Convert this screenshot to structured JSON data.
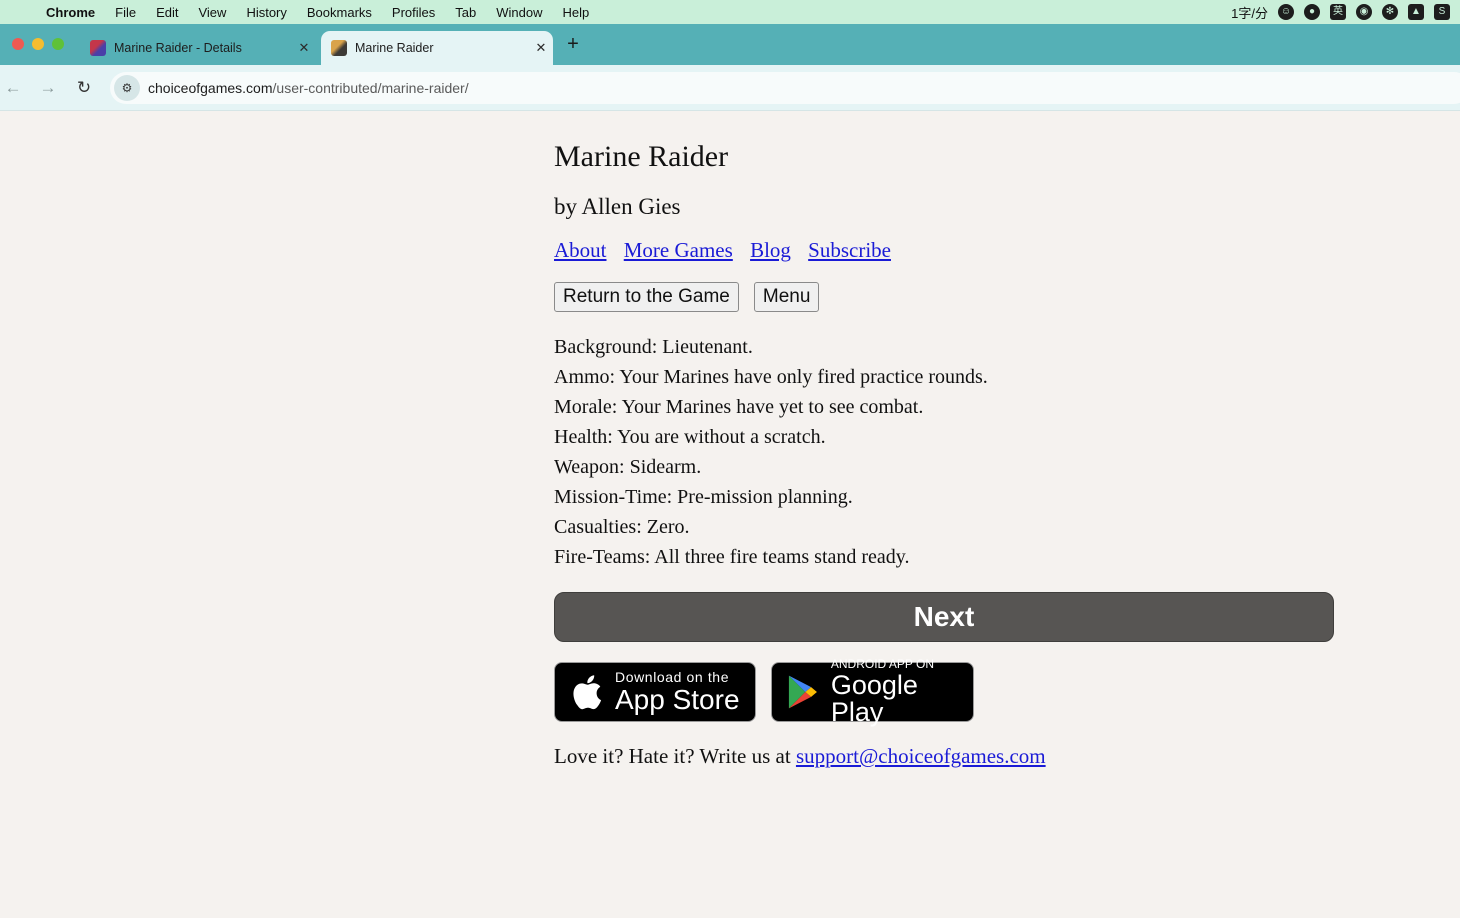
{
  "menubar": {
    "app_name": "Chrome",
    "items": [
      "File",
      "Edit",
      "View",
      "History",
      "Bookmarks",
      "Profiles",
      "Tab",
      "Window",
      "Help"
    ],
    "status_text": "1字/分"
  },
  "tabs": [
    {
      "title": "Marine Raider - Details",
      "active": false
    },
    {
      "title": "Marine Raider",
      "active": true
    }
  ],
  "address_bar": {
    "domain": "choiceofgames.com",
    "path": "/user-contributed/marine-raider/"
  },
  "page": {
    "title": "Marine Raider",
    "byline": "by Allen Gies",
    "links": [
      "About",
      "More Games",
      "Blog",
      "Subscribe"
    ],
    "buttons": {
      "return_label": "Return to the Game",
      "menu_label": "Menu"
    },
    "stats": [
      "Background: Lieutenant.",
      "Ammo: Your Marines have only fired practice rounds.",
      "Morale: Your Marines have yet to see combat.",
      "Health: You are without a scratch.",
      "Weapon: Sidearm.",
      "Mission-Time: Pre-mission planning.",
      "Casualties: Zero.",
      "Fire-Teams: All three fire teams stand ready."
    ],
    "next_label": "Next",
    "app_store": {
      "small": "Download on the",
      "big": "App Store"
    },
    "google_play": {
      "small": "ANDROID APP ON",
      "big": "Google Play"
    },
    "contact": {
      "prefix": "Love it? Hate it? Write us at ",
      "email": "support@choiceofgames.com"
    }
  }
}
